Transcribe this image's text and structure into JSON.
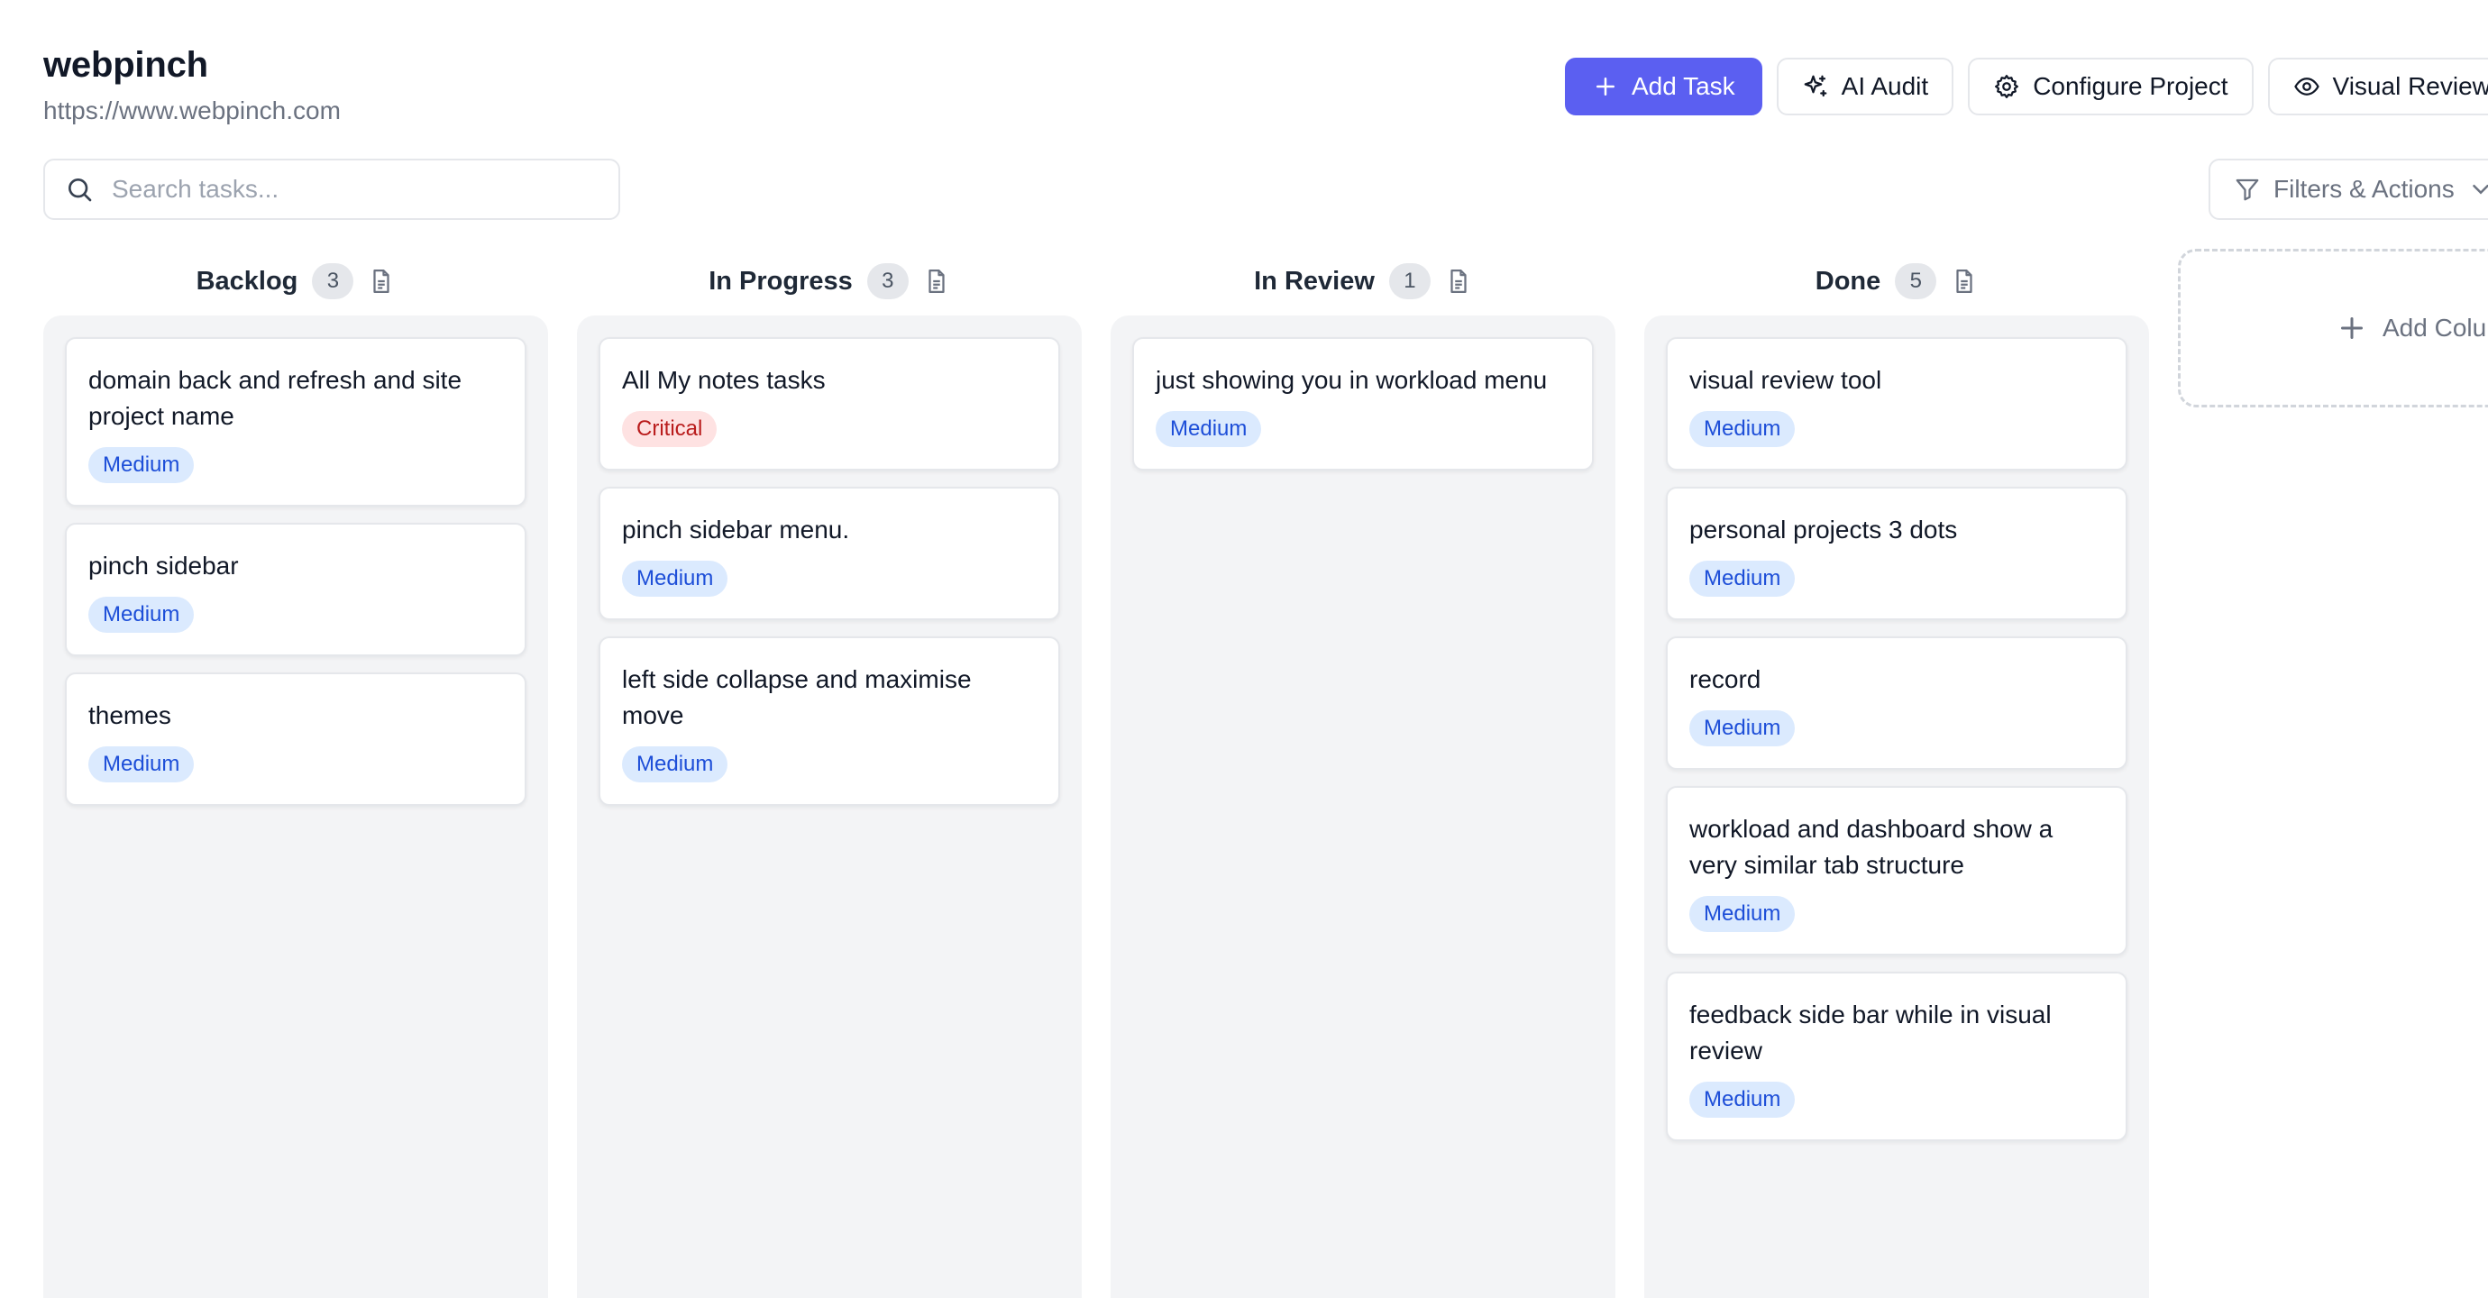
{
  "project": {
    "name": "webpinch",
    "url": "https://www.webpinch.com"
  },
  "toolbar": {
    "add_task": "Add Task",
    "ai_audit": "AI Audit",
    "configure_project": "Configure Project",
    "visual_review": "Visual Review"
  },
  "search": {
    "placeholder": "Search tasks..."
  },
  "filters": {
    "label": "Filters & Actions"
  },
  "columns": [
    {
      "title": "Backlog",
      "count": "3",
      "cards": [
        {
          "title": "domain back and refresh and site project name",
          "priority": "Medium"
        },
        {
          "title": "pinch sidebar",
          "priority": "Medium"
        },
        {
          "title": "themes",
          "priority": "Medium"
        }
      ]
    },
    {
      "title": "In Progress",
      "count": "3",
      "cards": [
        {
          "title": "All My notes tasks",
          "priority": "Critical"
        },
        {
          "title": "pinch sidebar menu.",
          "priority": "Medium"
        },
        {
          "title": "left side collapse and maximise move",
          "priority": "Medium"
        }
      ]
    },
    {
      "title": "In Review",
      "count": "1",
      "cards": [
        {
          "title": "just showing you in workload menu",
          "priority": "Medium"
        }
      ]
    },
    {
      "title": "Done",
      "count": "5",
      "cards": [
        {
          "title": "visual review tool",
          "priority": "Medium"
        },
        {
          "title": "personal projects 3 dots",
          "priority": "Medium"
        },
        {
          "title": "record",
          "priority": "Medium"
        },
        {
          "title": "workload and dashboard show a very similar tab structure",
          "priority": "Medium"
        },
        {
          "title": "feedback side bar while in visual review",
          "priority": "Medium"
        }
      ]
    }
  ],
  "add_column": {
    "label": "Add Column"
  },
  "colors": {
    "primary": "#5b5ff1",
    "medium_badge_bg": "#dbeafe",
    "medium_badge_text": "#1d4ed8",
    "critical_badge_bg": "#fee2e2",
    "critical_badge_text": "#b91c1c",
    "column_bg": "#f3f4f6"
  }
}
